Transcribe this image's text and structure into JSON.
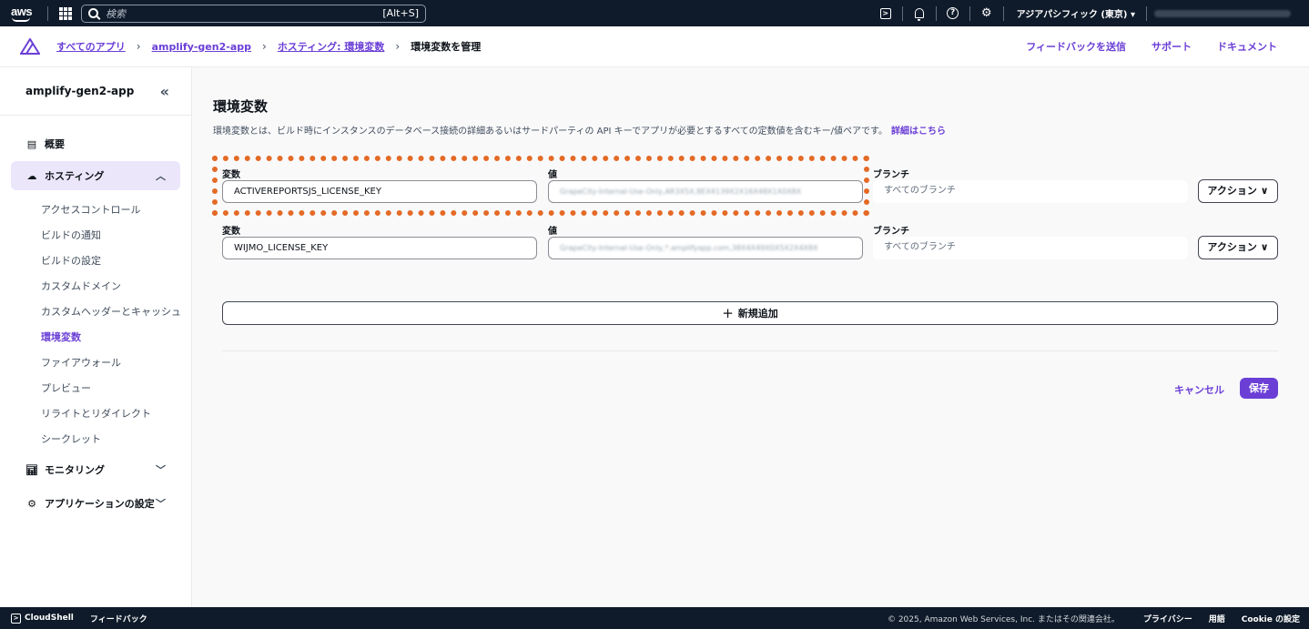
{
  "topnav": {
    "logo": "aws",
    "search_placeholder": "検索",
    "search_shortcut": "[Alt+S]",
    "region": "アジアパシフィック (東京) ▾",
    "icons": [
      "cloudshell-icon",
      "bell-icon",
      "help-icon",
      "gear-icon"
    ]
  },
  "breadcrumb": {
    "items": [
      "すべてのアプリ",
      "amplify-gen2-app",
      "ホスティング: 環境変数"
    ],
    "current": "環境変数を管理",
    "links": [
      "フィードバックを送信",
      "サポート",
      "ドキュメント"
    ]
  },
  "sidebar": {
    "title": "amplify-gen2-app",
    "overview": "概要",
    "hosting": "ホスティング",
    "sub_items": [
      "アクセスコントロール",
      "ビルドの通知",
      "ビルドの設定",
      "カスタムドメイン",
      "カスタムヘッダーとキャッシュ",
      "環境変数",
      "ファイアウォール",
      "プレビュー",
      "リライトとリダイレクト",
      "シークレット"
    ],
    "current_sub": "環境変数",
    "monitoring": "モニタリング",
    "app_settings": "アプリケーションの設定"
  },
  "main": {
    "title": "環境変数",
    "description": "環境変数とは、ビルド時にインスタンスのデータベース接続の詳細あるいはサードパーティの API キーでアプリが必要とするすべての定数値を含むキー/値ペアです。",
    "learn_more": "詳細はこちら",
    "rows": [
      {
        "var_label": "変数",
        "var_value": "ACTIVEREPORTSJS_LICENSE_KEY",
        "val_label": "値",
        "val_value": "GrapeCity-Internal-Use-Only,AR3X5X,8EX4139X2X16X48X1X0X8X",
        "branch_label": "ブランチ",
        "branch_value": "すべてのブランチ",
        "action": "アクション ∨"
      },
      {
        "var_label": "変数",
        "var_value": "WIJMO_LICENSE_KEY",
        "val_label": "値",
        "val_value": "GrapeCity-Internal-Use-Only,*.amplifyapp.com,38X4X49X0X5X2X4X8X",
        "branch_label": "ブランチ",
        "branch_value": "すべてのブランチ",
        "action": "アクション ∨"
      }
    ],
    "add_button": "新規追加",
    "cancel": "キャンセル",
    "save": "保存"
  },
  "footer": {
    "cloudshell": "CloudShell",
    "feedback": "フィードバック",
    "copyright": "© 2025, Amazon Web Services, Inc. またはその関連会社。",
    "links": [
      "プライバシー",
      "用語",
      "Cookie の設定"
    ]
  },
  "colors": {
    "accent": "#6b3fd6",
    "highlight": "#e46a26",
    "nav_bg": "#0f1b2a"
  }
}
